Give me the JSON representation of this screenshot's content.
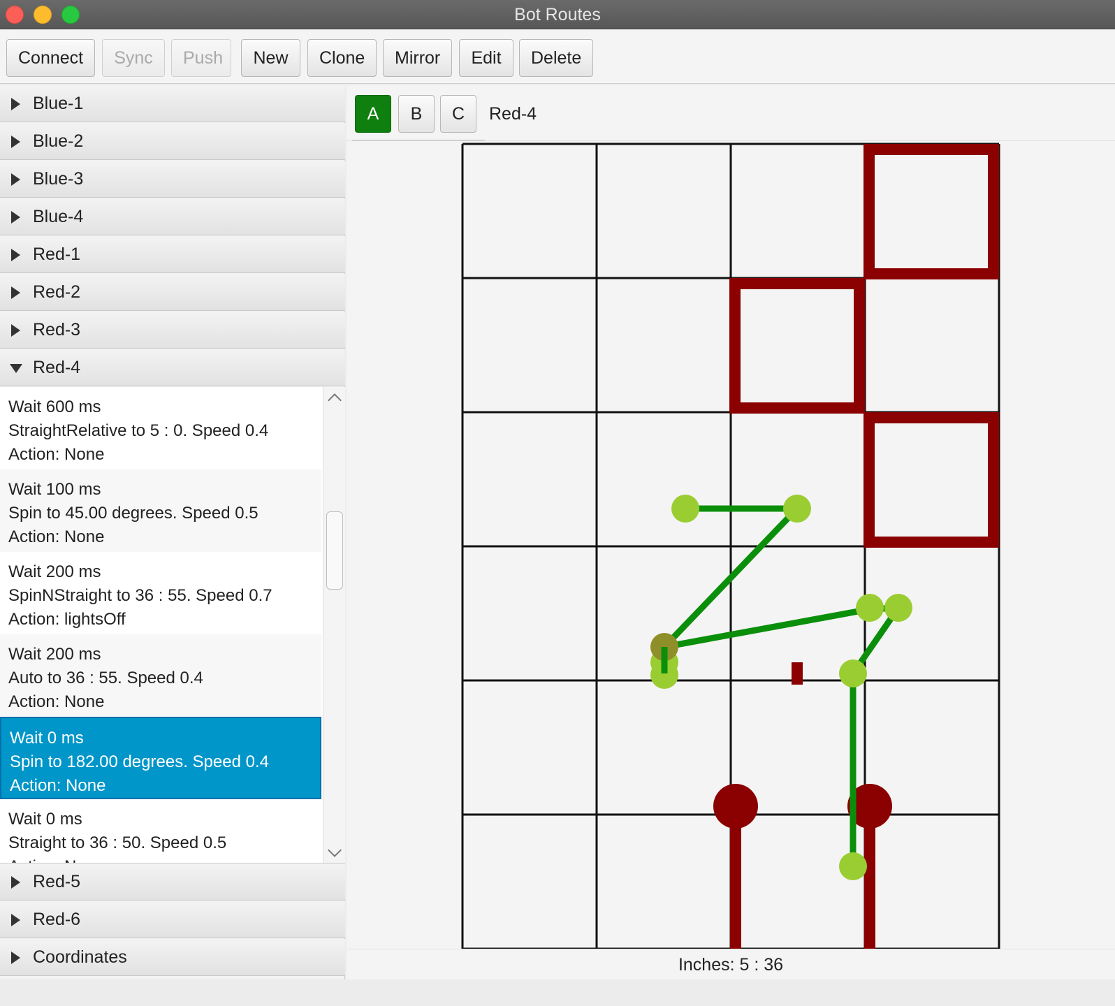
{
  "window": {
    "title": "Bot Routes"
  },
  "toolbar": {
    "connect": "Connect",
    "sync": "Sync",
    "push": "Push",
    "new": "New",
    "clone": "Clone",
    "mirror": "Mirror",
    "edit": "Edit",
    "delete": "Delete"
  },
  "sidebar": {
    "routes_top": [
      "Blue-1",
      "Blue-2",
      "Blue-3",
      "Blue-4",
      "Red-1",
      "Red-2",
      "Red-3"
    ],
    "expanded": "Red-4",
    "routes_bottom": [
      "Red-5",
      "Red-6",
      "Coordinates"
    ],
    "steps": [
      {
        "wait": "Wait 600 ms",
        "move": "StraightRelative to 5 : 0. Speed 0.4",
        "action": "Action: None"
      },
      {
        "wait": "Wait 100 ms",
        "move": "Spin to 45.00 degrees. Speed 0.5",
        "action": "Action: None"
      },
      {
        "wait": "Wait 200 ms",
        "move": "SpinNStraight to 36 : 55. Speed 0.7",
        "action": "Action: lightsOff"
      },
      {
        "wait": "Wait 200 ms",
        "move": "Auto to 36 : 55. Speed 0.4",
        "action": "Action: None"
      },
      {
        "wait": "Wait 0 ms",
        "move": "Spin to 182.00 degrees. Speed 0.4",
        "action": "Action: None"
      },
      {
        "wait": "Wait 0 ms",
        "move": "Straight to 36 : 50. Speed 0.5",
        "action": "Action: None"
      }
    ],
    "selected_step": 4
  },
  "tabs": {
    "a": "A",
    "b": "B",
    "c": "C",
    "active": "A"
  },
  "route_name": "Red-4",
  "field": {
    "grid_cols": 4,
    "grid_rows": 6,
    "colors": {
      "grid_line": "#111111",
      "obstacle": "#8b0000",
      "path": "#0b8f0b",
      "waypoint": "#9acd32",
      "current_waypoint": "#8f8f2a",
      "background": "#f4f4f4"
    }
  },
  "status": {
    "coords": "Inches: 5 : 36"
  }
}
